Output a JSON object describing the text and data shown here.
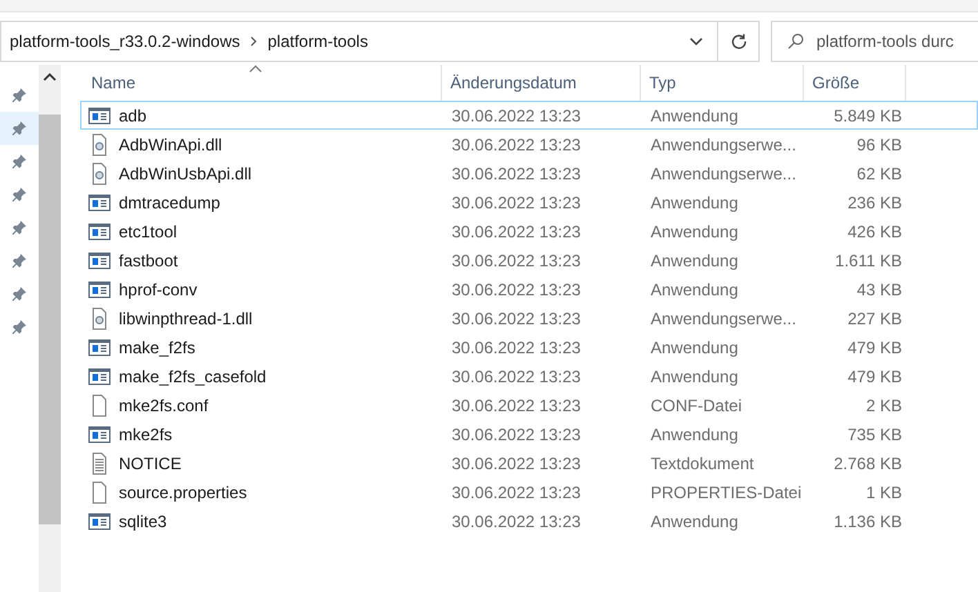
{
  "address_bar": {
    "path": [
      "platform-tools_r33.0.2-windows",
      "platform-tools"
    ]
  },
  "search": {
    "placeholder": "platform-tools durc"
  },
  "table": {
    "columns": [
      "Name",
      "Änderungsdatum",
      "Typ",
      "Größe"
    ],
    "rows": [
      {
        "kind": "app",
        "name": "adb",
        "date": "30.06.2022 13:23",
        "type": "Anwendung",
        "size": "5.849 KB",
        "selected": true
      },
      {
        "kind": "dll",
        "name": "AdbWinApi.dll",
        "date": "30.06.2022 13:23",
        "type": "Anwendungserwe...",
        "size": "96 KB",
        "selected": false
      },
      {
        "kind": "dll",
        "name": "AdbWinUsbApi.dll",
        "date": "30.06.2022 13:23",
        "type": "Anwendungserwe...",
        "size": "62 KB",
        "selected": false
      },
      {
        "kind": "app",
        "name": "dmtracedump",
        "date": "30.06.2022 13:23",
        "type": "Anwendung",
        "size": "236 KB",
        "selected": false
      },
      {
        "kind": "app",
        "name": "etc1tool",
        "date": "30.06.2022 13:23",
        "type": "Anwendung",
        "size": "426 KB",
        "selected": false
      },
      {
        "kind": "app",
        "name": "fastboot",
        "date": "30.06.2022 13:23",
        "type": "Anwendung",
        "size": "1.611 KB",
        "selected": false
      },
      {
        "kind": "app",
        "name": "hprof-conv",
        "date": "30.06.2022 13:23",
        "type": "Anwendung",
        "size": "43 KB",
        "selected": false
      },
      {
        "kind": "dll",
        "name": "libwinpthread-1.dll",
        "date": "30.06.2022 13:23",
        "type": "Anwendungserwe...",
        "size": "227 KB",
        "selected": false
      },
      {
        "kind": "app",
        "name": "make_f2fs",
        "date": "30.06.2022 13:23",
        "type": "Anwendung",
        "size": "479 KB",
        "selected": false
      },
      {
        "kind": "app",
        "name": "make_f2fs_casefold",
        "date": "30.06.2022 13:23",
        "type": "Anwendung",
        "size": "479 KB",
        "selected": false
      },
      {
        "kind": "file",
        "name": "mke2fs.conf",
        "date": "30.06.2022 13:23",
        "type": "CONF-Datei",
        "size": "2 KB",
        "selected": false
      },
      {
        "kind": "app",
        "name": "mke2fs",
        "date": "30.06.2022 13:23",
        "type": "Anwendung",
        "size": "735 KB",
        "selected": false
      },
      {
        "kind": "text",
        "name": "NOTICE",
        "date": "30.06.2022 13:23",
        "type": "Textdokument",
        "size": "2.768 KB",
        "selected": false
      },
      {
        "kind": "file",
        "name": "source.properties",
        "date": "30.06.2022 13:23",
        "type": "PROPERTIES-Datei",
        "size": "1 KB",
        "selected": false
      },
      {
        "kind": "app",
        "name": "sqlite3",
        "date": "30.06.2022 13:23",
        "type": "Anwendung",
        "size": "1.136 KB",
        "selected": false
      }
    ]
  }
}
